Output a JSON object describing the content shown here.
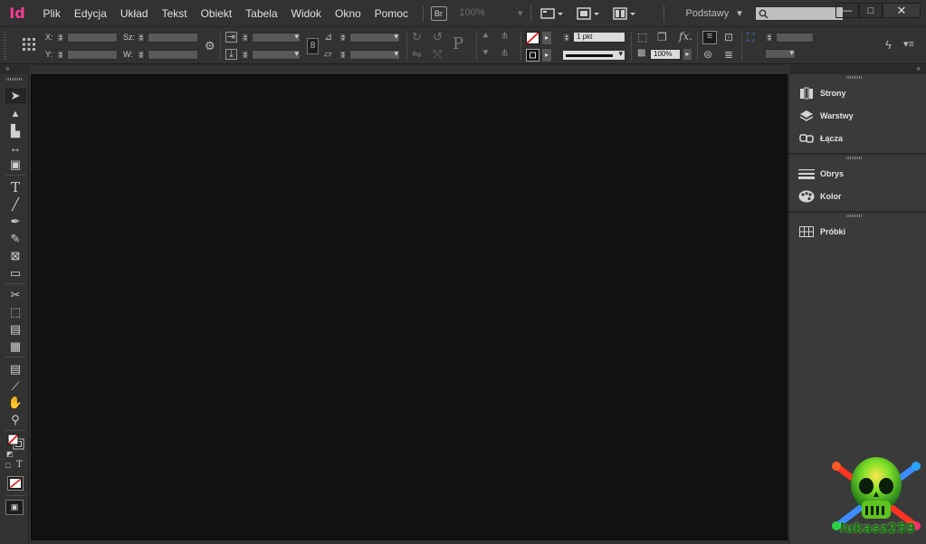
{
  "app": {
    "logo": "Id",
    "brand_color": "#ff3d9a"
  },
  "menu": [
    "Plik",
    "Edycja",
    "Układ",
    "Tekst",
    "Obiekt",
    "Tabela",
    "Widok",
    "Okno",
    "Pomoc"
  ],
  "toolbar": {
    "bridge_label": "Br",
    "zoom": "100%",
    "workspace": "Podstawy",
    "search_placeholder": ""
  },
  "window_controls": {
    "minimize": "—",
    "maximize": "□",
    "close": "✕"
  },
  "control": {
    "x_label": "X:",
    "y_label": "Y:",
    "w_label": "Sz:",
    "h_label": "W:",
    "stroke_weight": "1 pkt",
    "opacity": "100%"
  },
  "panels": [
    {
      "group": "pages",
      "items": [
        {
          "name": "strony",
          "label": "Strony",
          "icon": "pages-icon"
        },
        {
          "name": "warstwy",
          "label": "Warstwy",
          "icon": "layers-icon"
        },
        {
          "name": "lacza",
          "label": "Łącza",
          "icon": "links-icon"
        }
      ]
    },
    {
      "group": "stroke",
      "items": [
        {
          "name": "obrys",
          "label": "Obrys",
          "icon": "stroke-icon"
        },
        {
          "name": "kolor",
          "label": "Kolor",
          "icon": "color-icon"
        }
      ]
    },
    {
      "group": "swatches",
      "items": [
        {
          "name": "probki",
          "label": "Próbki",
          "icon": "swatches-icon"
        }
      ]
    }
  ],
  "watermark": {
    "text": "lukasz259"
  },
  "colors": {
    "canvas": "#111111",
    "ui": "#323232",
    "panel": "#3a3a3a"
  }
}
